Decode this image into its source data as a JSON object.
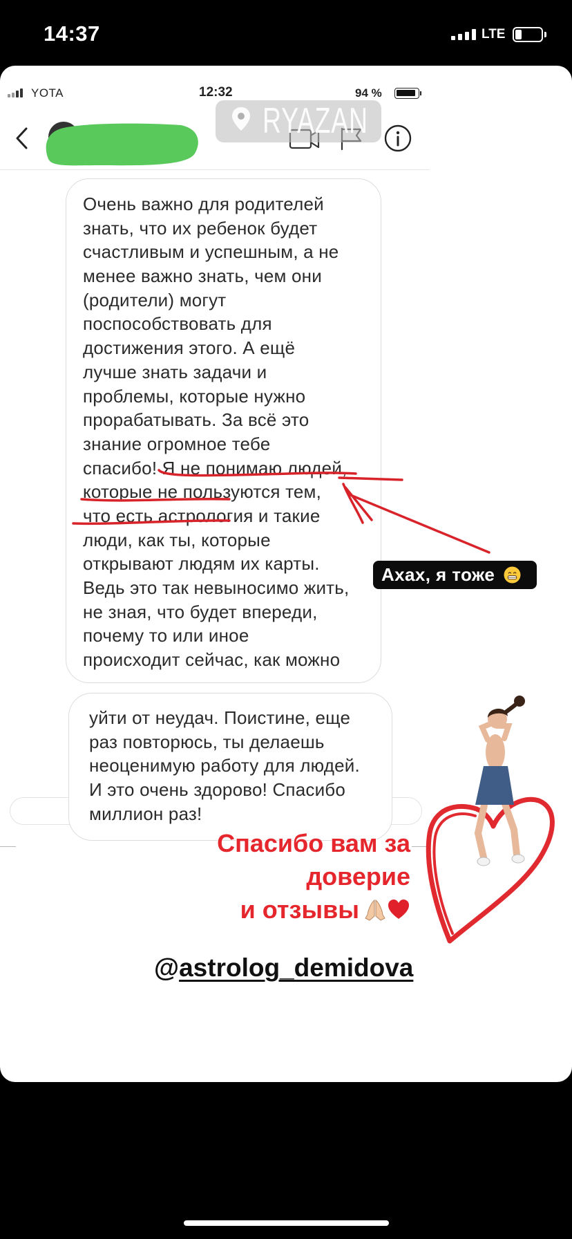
{
  "status_bar": {
    "time": "14:37",
    "network": "LTE",
    "battery_level": 0.25,
    "signal_icon": "cellular-signal-icon",
    "battery_icon": "battery-icon"
  },
  "inner": {
    "status_bar": {
      "carrier": "YOTA",
      "time": "12:32",
      "battery": "94 %",
      "battery_level": 0.94
    },
    "location_sticker": {
      "icon": "location-pin-icon",
      "label": "RYAZAN"
    },
    "header": {
      "back_icon": "chevron-left-icon",
      "avatar": "redacted-avatar",
      "video_icon": "video-camera-icon",
      "flag_icon": "flag-icon",
      "info_icon": "info-icon"
    },
    "messages": [
      {
        "lines": [
          "Очень важно для родителей",
          "знать, что их ребенок будет",
          "счастливым и успешным, а не",
          "менее важно знать, чем они",
          "(родители) могут",
          "поспособствовать для",
          "достижения этого. А ещё",
          "лучше знать задачи и",
          "проблемы, которые нужно",
          "прорабатывать. За всё это",
          "знание огромное тебе",
          "спасибо! Я не понимаю людей,",
          "которые не пользуются тем,",
          "что есть астрология и такие",
          "люди, как ты, которые",
          "открывают людям их карты.",
          "Ведь это так невыносимо жить,",
          "не зная, что будет впереди,",
          "почему то или иное",
          "происходит сейчас, как можно"
        ]
      },
      {
        "lines": [
          "уйти от неудач. Поистине, еще",
          "раз повторюсь, ты делаешь",
          "неоценимую работу для людей.",
          "И это очень здорово! Спасибо",
          "миллион раз!"
        ]
      }
    ]
  },
  "reply_sticker": {
    "text": "Ахах, я тоже",
    "emoji": "grinning-face-emoji"
  },
  "caption": {
    "lines": [
      "Спасибо вам за",
      "доверие",
      "и отзывы"
    ],
    "emojis": [
      "folded-hands-emoji",
      "red-heart-emoji"
    ]
  },
  "mention": {
    "at": "@",
    "handle": "astrolog_demidova"
  },
  "stickers": {
    "dancer": "dancing-girl-sticker",
    "heart": "hand-drawn-heart"
  },
  "colors": {
    "background": "#000000",
    "card": "#ffffff",
    "annotation_red": "#d8232a",
    "caption_red": "#e5262d",
    "redaction_green": "#58c95a",
    "bubble_border": "#dcdcdc"
  }
}
